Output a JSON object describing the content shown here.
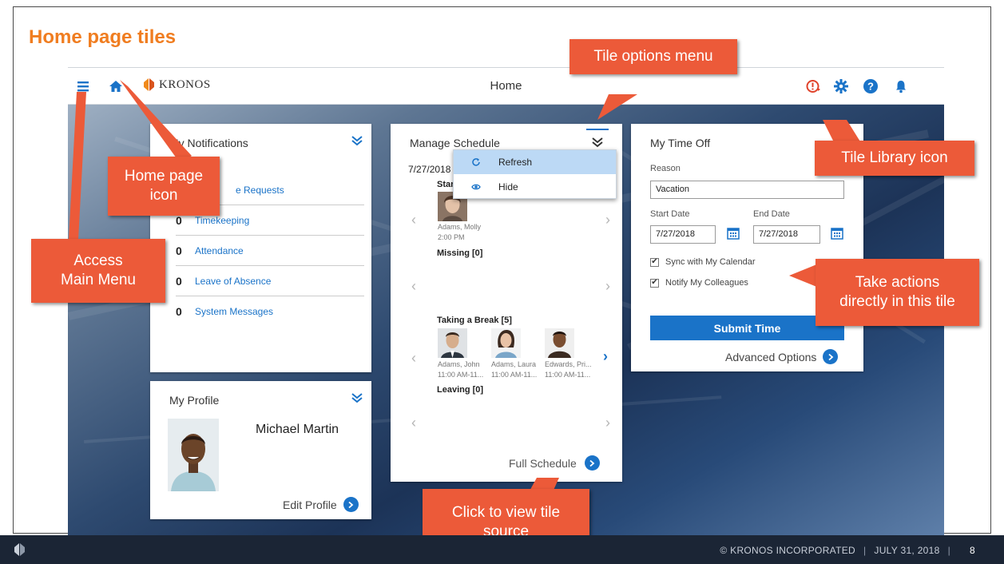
{
  "slide": {
    "title": "Home page tiles",
    "footer": {
      "copyright": "© KRONOS INCORPORATED",
      "date": "JULY 31, 2018",
      "page": "8"
    }
  },
  "topbar": {
    "title": "Home",
    "logo_text": "KRONOS"
  },
  "notifications": {
    "title": "My Notifications",
    "items": [
      {
        "count": "",
        "label": "Time-Off Requests",
        "visible_label": "e Requests"
      },
      {
        "count": "0",
        "label": "Timekeeping"
      },
      {
        "count": "0",
        "label": "Attendance"
      },
      {
        "count": "0",
        "label": "Leave of Absence"
      },
      {
        "count": "0",
        "label": "System Messages"
      }
    ]
  },
  "profile": {
    "title": "My Profile",
    "name": "Michael Martin",
    "edit_label": "Edit Profile"
  },
  "schedule": {
    "title": "Manage Schedule",
    "date": "7/27/2018",
    "started_label": "Star",
    "started_person": {
      "name": "Adams, Molly",
      "time": "2:00 PM"
    },
    "missing_label": "Missing [0]",
    "break_label": "Taking a Break [5]",
    "break_people": [
      {
        "name": "Adams, John",
        "time": "11:00 AM-11..."
      },
      {
        "name": "Adams, Laura",
        "time": "11:00 AM-11..."
      },
      {
        "name": "Edwards, Pri...",
        "time": "11:00 AM-11..."
      }
    ],
    "leaving_label": "Leaving [0]",
    "full_label": "Full Schedule",
    "menu": {
      "refresh": "Refresh",
      "hide": "Hide"
    }
  },
  "timeoff": {
    "title": "My Time Off",
    "reason_label": "Reason",
    "reason_value": "Vacation",
    "start_label": "Start Date",
    "end_label": "End Date",
    "start_value": "7/27/2018",
    "end_value": "7/27/2018",
    "sync_label": "Sync with My Calendar",
    "notify_label": "Notify My Colleagues",
    "submit_label": "Submit Time",
    "advanced_label": "Advanced Options"
  },
  "callouts": {
    "tile_options": "Tile options menu",
    "tile_library": "Tile Library icon",
    "home_icon_line1": "Home page",
    "home_icon_line2": "icon",
    "main_menu_line1": "Access",
    "main_menu_line2": "Main Menu",
    "actions_line1": "Take actions",
    "actions_line2": "directly in this tile",
    "source_line1": "Click to view tile",
    "source_line2": "source"
  },
  "colors": {
    "accent": "#1a73c8",
    "callout": "#ec5a39",
    "title": "#f07d20",
    "footer": "#1b2535"
  }
}
